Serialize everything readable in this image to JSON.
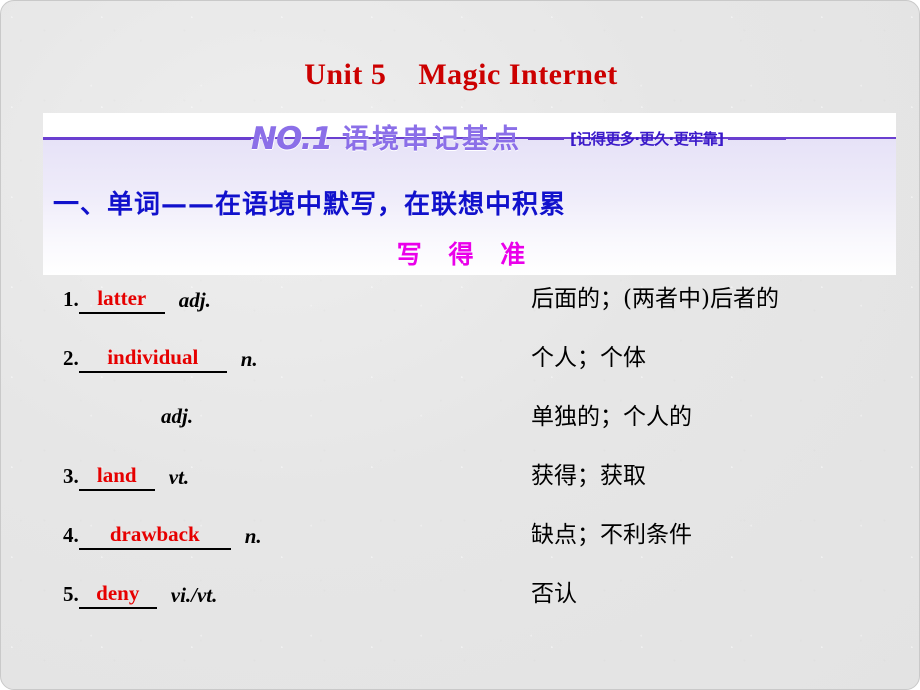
{
  "slide": {
    "unit_title": "Unit 5    Magic Internet",
    "background_color": "#e6e6e6"
  },
  "banner": {
    "no_label": "NO.1",
    "title_cn": "语境串记基点",
    "tagline": "[记得更多·更久·更牢靠]",
    "accent_color": "#8b6fe8",
    "rule_color": "#6a3fd0",
    "tagline_color": "#3a19c9"
  },
  "section": {
    "heading": "一、单词——在语境中默写，在联想中积累",
    "heading_color": "#1111cc",
    "sub_heading": "写 得 准",
    "sub_heading_color": "#ea00ea"
  },
  "word_list": {
    "word_color": "#e60000",
    "rows": [
      {
        "index": "1.",
        "word": "latter",
        "pos": "adj.",
        "meaning": "后面的；(两者中)后者的",
        "pos_only": false
      },
      {
        "index": "2.",
        "word": "individual",
        "pos": "n.",
        "meaning": "个人；个体",
        "pos_only": false
      },
      {
        "index": "",
        "word": "",
        "pos": "adj.",
        "meaning": "单独的；个人的",
        "pos_only": true
      },
      {
        "index": "3.",
        "word": "land",
        "pos": "vt.",
        "meaning": "获得；获取",
        "pos_only": false
      },
      {
        "index": "4.",
        "word": "drawback",
        "pos": "n.",
        "meaning": "缺点；不利条件",
        "pos_only": false
      },
      {
        "index": "5.",
        "word": "deny",
        "pos": "vi./vt.",
        "meaning": "否认",
        "pos_only": false
      }
    ]
  }
}
